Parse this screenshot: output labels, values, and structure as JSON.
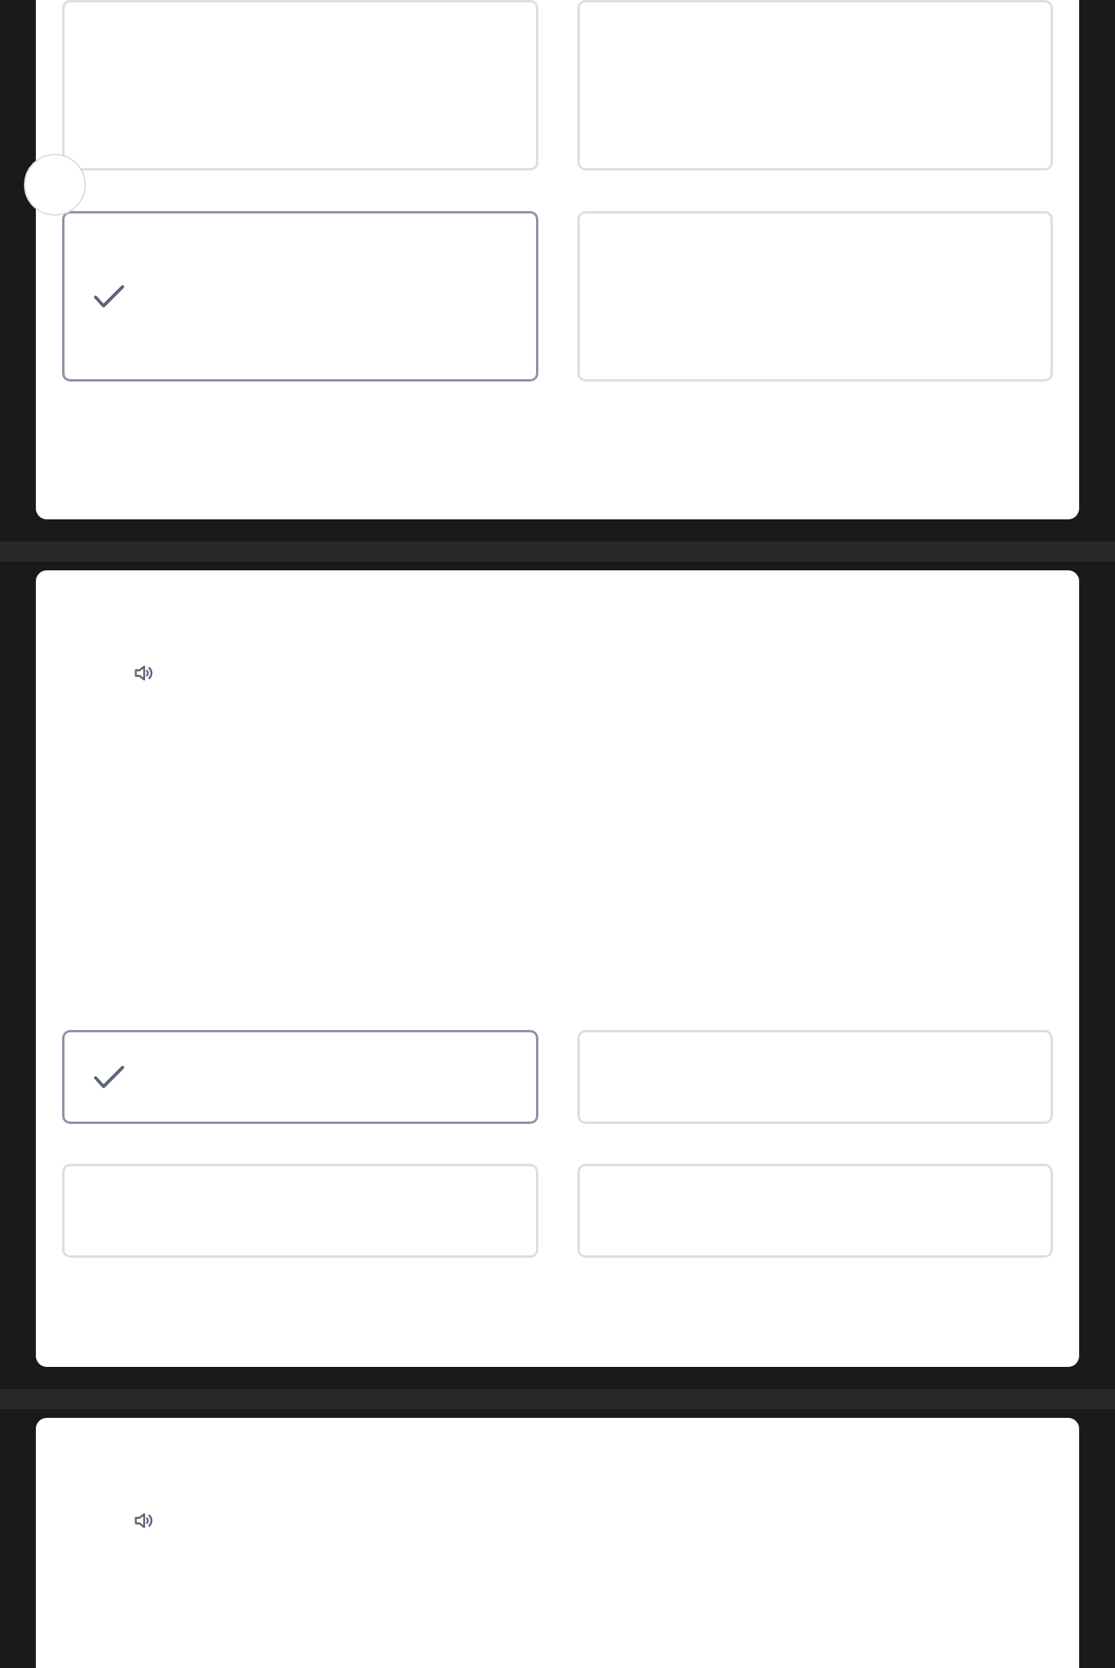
{
  "cards": [
    {
      "kind": "tall",
      "audio": false,
      "options": [
        {
          "selected": false
        },
        {
          "selected": false
        },
        {
          "selected": true
        },
        {
          "selected": false
        }
      ]
    },
    {
      "kind": "short",
      "audio": true,
      "options": [
        {
          "selected": true
        },
        {
          "selected": false
        },
        {
          "selected": false
        },
        {
          "selected": false
        }
      ]
    },
    {
      "kind": "short",
      "audio": true
    }
  ]
}
